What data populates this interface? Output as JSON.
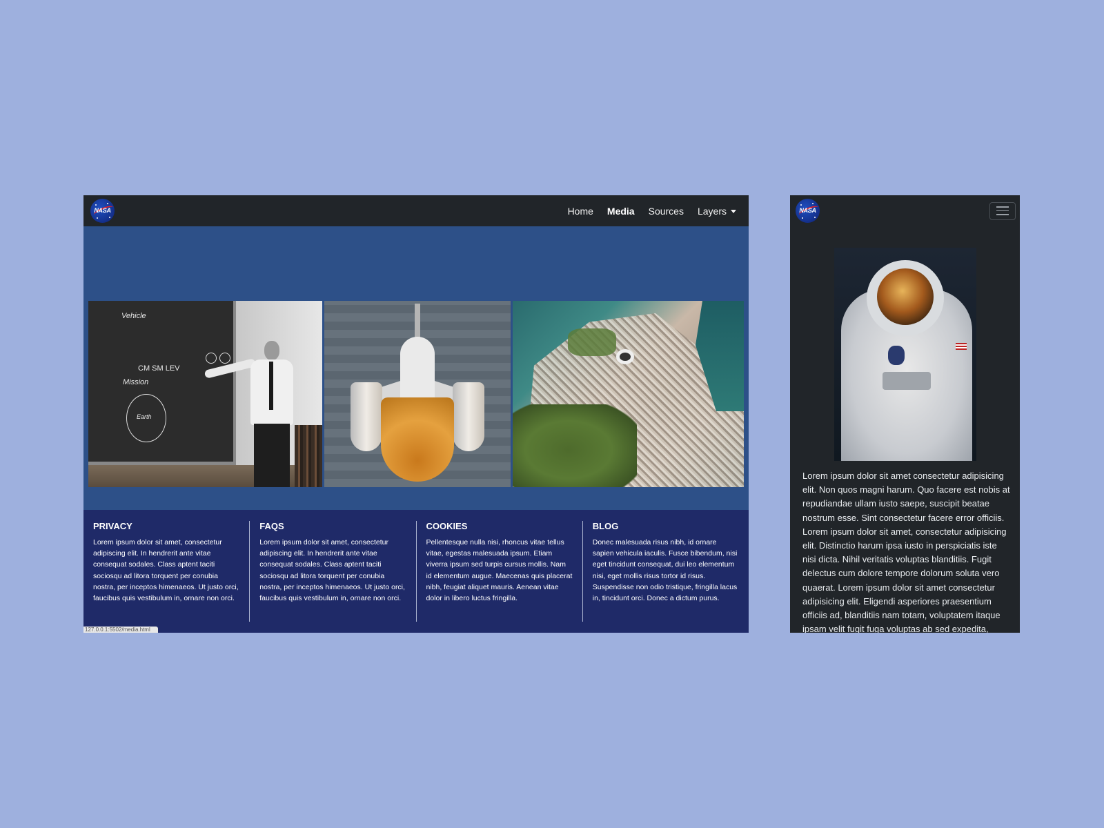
{
  "desktop": {
    "brand": {
      "logo_text": "NASA"
    },
    "nav": [
      {
        "label": "Home",
        "active": false
      },
      {
        "label": "Media",
        "active": true
      },
      {
        "label": "Sources",
        "active": false
      },
      {
        "label": "Layers",
        "active": false,
        "dropdown": true
      }
    ],
    "gallery": [
      {
        "alt": "Scientist at chalkboard",
        "chalk": [
          "Vehicle",
          "CM  SM  LEV",
          "Mission",
          "Earth"
        ]
      },
      {
        "alt": "Space shuttle on launch pad"
      },
      {
        "alt": "Aerial view of coastal city"
      }
    ],
    "footer": [
      {
        "heading": "PRIVACY",
        "text": "Lorem ipsum dolor sit amet, consectetur adipiscing elit. In hendrerit ante vitae consequat sodales. Class aptent taciti sociosqu ad litora torquent per conubia nostra, per inceptos himenaeos. Ut justo orci, faucibus quis vestibulum in, ornare non orci."
      },
      {
        "heading": "FAQS",
        "text": "Lorem ipsum dolor sit amet, consectetur adipiscing elit. In hendrerit ante vitae consequat sodales. Class aptent taciti sociosqu ad litora torquent per conubia nostra, per inceptos himenaeos. Ut justo orci, faucibus quis vestibulum in, ornare non orci."
      },
      {
        "heading": "COOKIES",
        "text": "Pellentesque nulla nisi, rhoncus vitae tellus vitae, egestas malesuada ipsum. Etiam viverra ipsum sed turpis cursus mollis. Nam id elementum augue. Maecenas quis placerat nibh, feugiat aliquet mauris. Aenean vitae dolor in libero luctus fringilla."
      },
      {
        "heading": "BLOG",
        "text": "Donec malesuada risus nibh, id ornare sapien vehicula iaculis. Fusce bibendum, nisi eget tincidunt consequat, dui leo elementum nisi, eget mollis risus tortor id risus. Suspendisse non odio tristique, fringilla lacus in, tincidunt orci. Donec a dictum purus."
      }
    ],
    "status_url": "127.0.0.1:5502/media.html"
  },
  "mobile": {
    "brand": {
      "logo_text": "NASA"
    },
    "image_alt": "Astronaut spacesuit on display",
    "body": "Lorem ipsum dolor sit amet consectetur adipisicing elit. Non quos magni harum. Quo facere est nobis at repudiandae ullam iusto saepe, suscipit beatae nostrum esse. Sint consectetur facere error officiis. Lorem ipsum dolor sit amet, consectetur adipisicing elit. Distinctio harum ipsa iusto in perspiciatis iste nisi dicta. Nihil veritatis voluptas blanditiis. Fugit delectus cum dolore tempore dolorum soluta vero quaerat. Lorem ipsum dolor sit amet consectetur adipisicing elit. Eligendi asperiores praesentium officiis ad, blanditiis nam totam, voluptatem itaque ipsam velit fugit fuga voluptas ab sed expedita, veritatis"
  },
  "colors": {
    "page_bg": "#9eb0de",
    "navbar": "#212529",
    "content_bg": "#2d5088",
    "footer_bg": "#1f2a68"
  }
}
